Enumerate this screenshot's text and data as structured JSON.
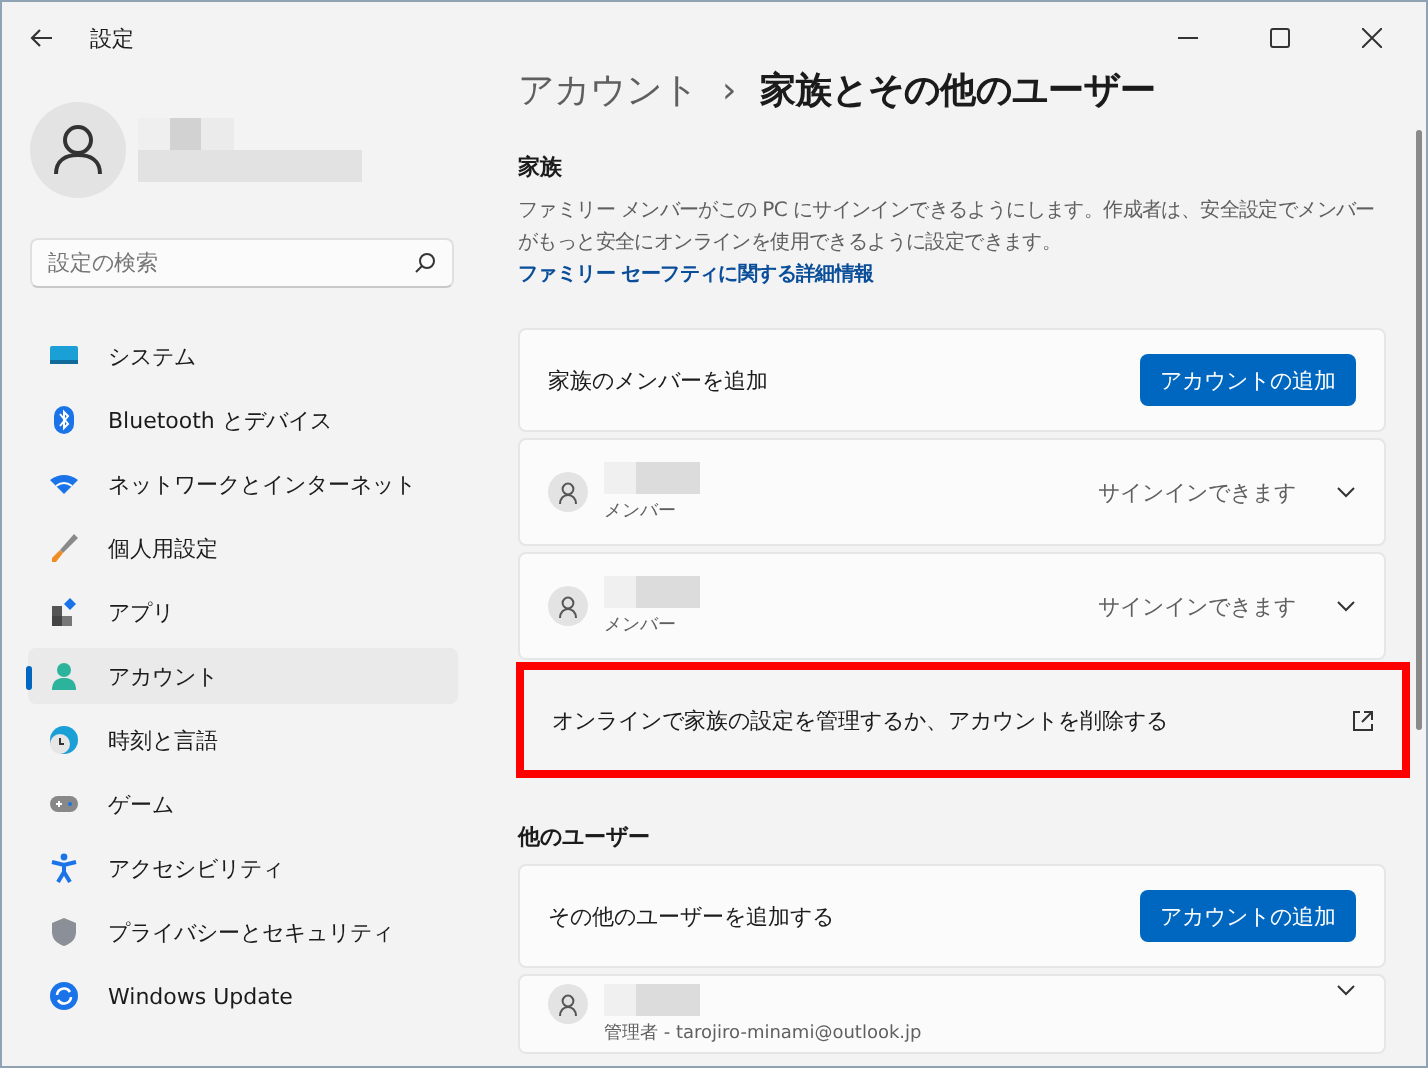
{
  "window": {
    "title": "設定"
  },
  "search": {
    "placeholder": "設定の検索"
  },
  "sidebar": {
    "items": [
      {
        "label": "システム",
        "selected": false
      },
      {
        "label": "Bluetooth とデバイス",
        "selected": false
      },
      {
        "label": "ネットワークとインターネット",
        "selected": false
      },
      {
        "label": "個人用設定",
        "selected": false
      },
      {
        "label": "アプリ",
        "selected": false
      },
      {
        "label": "アカウント",
        "selected": true
      },
      {
        "label": "時刻と言語",
        "selected": false
      },
      {
        "label": "ゲーム",
        "selected": false
      },
      {
        "label": "アクセシビリティ",
        "selected": false
      },
      {
        "label": "プライバシーとセキュリティ",
        "selected": false
      },
      {
        "label": "Windows Update",
        "selected": false
      }
    ]
  },
  "breadcrumb": {
    "parent": "アカウント",
    "separator": "›",
    "current": "家族とその他のユーザー"
  },
  "family": {
    "heading": "家族",
    "description": "ファミリー メンバーがこの PC にサインインできるようにします。作成者は、安全設定でメンバーがもっと安全にオンラインを使用できるように設定できます。",
    "link": "ファミリー セーフティに関する詳細情報",
    "add_label": "家族のメンバーを追加",
    "add_button": "アカウントの追加",
    "members": [
      {
        "role": "メンバー",
        "status": "サインインできます"
      },
      {
        "role": "メンバー",
        "status": "サインインできます"
      }
    ],
    "manage": {
      "label": "オンラインで家族の設定を管理するか、アカウントを削除する",
      "highlighted": true
    }
  },
  "other_users": {
    "heading": "他のユーザー",
    "add_label": "その他のユーザーを追加する",
    "add_button": "アカウントの追加",
    "users": [
      {
        "role": "管理者 - tarojiro-minami@outlook.jp"
      }
    ]
  }
}
